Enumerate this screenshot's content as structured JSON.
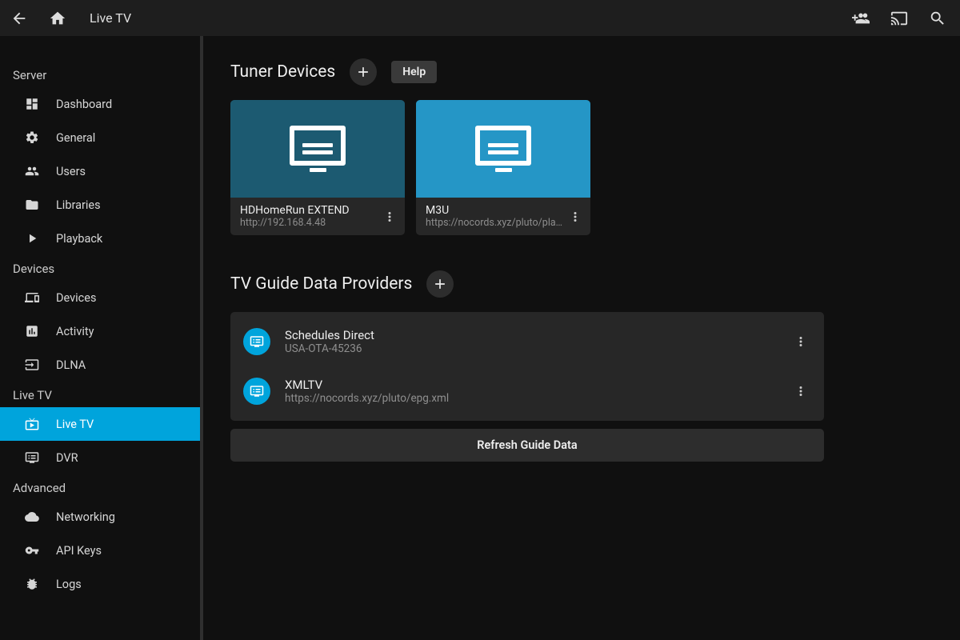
{
  "header": {
    "title": "Live TV"
  },
  "sidebar": {
    "sections": [
      {
        "label": "Server",
        "items": [
          {
            "id": "dashboard",
            "label": "Dashboard"
          },
          {
            "id": "general",
            "label": "General"
          },
          {
            "id": "users",
            "label": "Users"
          },
          {
            "id": "libraries",
            "label": "Libraries"
          },
          {
            "id": "playback",
            "label": "Playback"
          }
        ]
      },
      {
        "label": "Devices",
        "items": [
          {
            "id": "devices",
            "label": "Devices"
          },
          {
            "id": "activity",
            "label": "Activity"
          },
          {
            "id": "dlna",
            "label": "DLNA"
          }
        ]
      },
      {
        "label": "Live TV",
        "items": [
          {
            "id": "livetv",
            "label": "Live TV",
            "active": true
          },
          {
            "id": "dvr",
            "label": "DVR"
          }
        ]
      },
      {
        "label": "Advanced",
        "items": [
          {
            "id": "networking",
            "label": "Networking"
          },
          {
            "id": "apikeys",
            "label": "API Keys"
          },
          {
            "id": "logs",
            "label": "Logs"
          }
        ]
      }
    ]
  },
  "main": {
    "tuners": {
      "title": "Tuner Devices",
      "help": "Help",
      "cards": [
        {
          "name": "HDHomeRun EXTEND",
          "sub": "http://192.168.4.48",
          "tone": "dark"
        },
        {
          "name": "M3U",
          "sub": "https://nocords.xyz/pluto/playlist…",
          "tone": "light"
        }
      ]
    },
    "providers": {
      "title": "TV Guide Data Providers",
      "items": [
        {
          "name": "Schedules Direct",
          "sub": "USA-OTA-45236"
        },
        {
          "name": "XMLTV",
          "sub": "https://nocords.xyz/pluto/epg.xml"
        }
      ],
      "refresh": "Refresh Guide Data"
    }
  }
}
